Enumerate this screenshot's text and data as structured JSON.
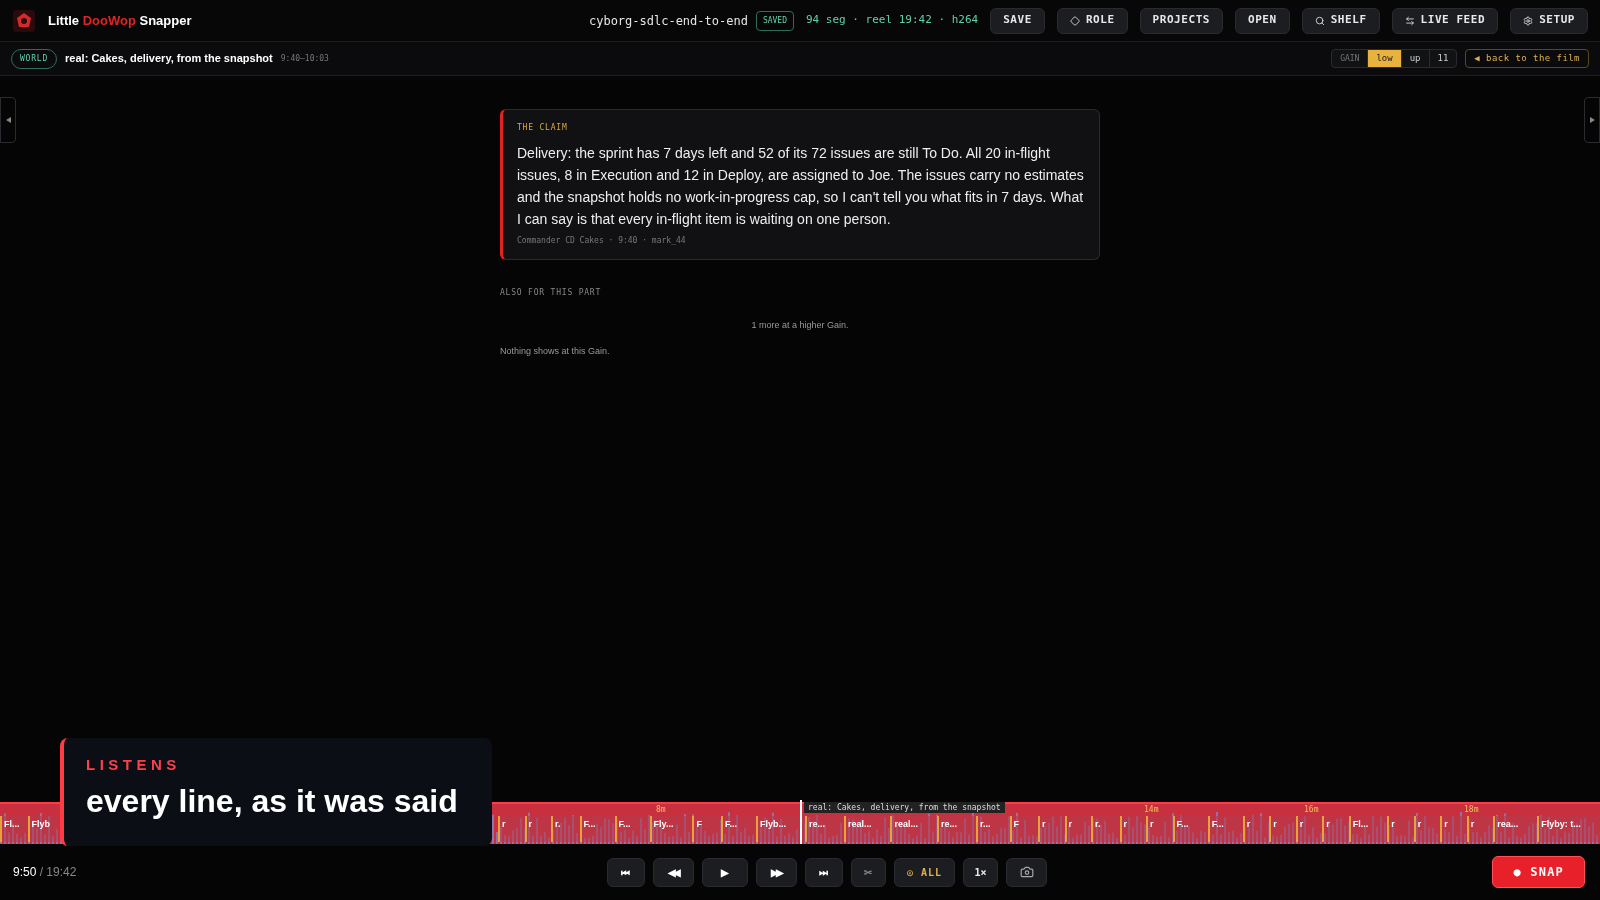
{
  "app": {
    "name_parts": [
      {
        "text": "Little ",
        "accent": false
      },
      {
        "text": "DooWop",
        "accent": true
      },
      {
        "text": " Snapper",
        "accent": false
      }
    ]
  },
  "project": {
    "name": "cyborg-sdlc-end-to-end",
    "status": "SAVED",
    "stats": "94 seg · reel 19:42 · h264"
  },
  "header_buttons": [
    {
      "label": "SAVE",
      "kind": "save"
    },
    {
      "label": "ROLE",
      "kind": "role"
    },
    {
      "label": "PROJECTS",
      "kind": "projects"
    },
    {
      "label": "OPEN",
      "kind": "open"
    },
    {
      "label": "SHELF",
      "kind": "shelf"
    },
    {
      "label": "LIVE FEED",
      "kind": "feed"
    },
    {
      "label": "SETUP",
      "kind": "setup"
    }
  ],
  "scene_bar": {
    "badge": "WORLD",
    "title": "real: Cakes, delivery, from the snapshot",
    "range": "9:40–10:03",
    "gain": {
      "label": "GAIN",
      "options": [
        {
          "label": "low",
          "selected": true
        },
        {
          "label": "up",
          "selected": false
        },
        {
          "label": "11",
          "selected": false
        }
      ]
    },
    "back_link": "◀ back to the film"
  },
  "claim": {
    "heading": "THE CLAIM",
    "text": "Delivery: the sprint has 7 days left and 52 of its 72 issues are still To Do. All 20 in-flight issues, 8 in Execution and 12 in Deploy, are assigned to Joe. The issues carry no estimates and the snapshot holds no work-in-progress cap, so I can't tell you what fits in 7 days. What I can say is that every in-flight item is waiting on one person.",
    "meta": "Commander CD Cakes · 9:40 · mark_44"
  },
  "also": {
    "heading": "ALSO FOR THIS PART",
    "more_note": "1 more at a higher Gain.",
    "empty_note": "Nothing shows at this Gain."
  },
  "caption": {
    "label": "LISTENS",
    "text": "every line, as it was said"
  },
  "timeline": {
    "playhead": {
      "level": 0.5,
      "tooltip": "real: Cakes, delivery, from the snapshot"
    },
    "ticks": [
      "8m",
      "14m",
      "16m",
      "18m"
    ],
    "segments_before": [
      "Fl...",
      "Flyb"
    ],
    "segments_after": [
      "r",
      "r",
      "r.",
      "F...",
      "F...",
      "Fly...",
      "F",
      "F...",
      "Flyb...",
      "re...",
      "real...",
      "real...",
      "re...",
      "r...",
      "F",
      "r",
      "r",
      "r.",
      "r",
      "r",
      "F...",
      "F...",
      "r",
      "r",
      "r",
      "r",
      "Fl...",
      "r",
      "r",
      "r",
      "r",
      "rea...",
      "Flyby: t..."
    ]
  },
  "transport": {
    "time": "9:50",
    "total": "/ 19:42",
    "buttons": [
      {
        "kind": "skip-back",
        "label": "⏮"
      },
      {
        "kind": "rewind",
        "label": "◀◀"
      },
      {
        "kind": "play",
        "label": "▶"
      },
      {
        "kind": "forward",
        "label": "▶▶"
      },
      {
        "kind": "skip-forward",
        "label": "⏭"
      },
      {
        "kind": "scissors",
        "label": "✂"
      },
      {
        "kind": "all",
        "label": "◎ ALL"
      },
      {
        "kind": "speed",
        "label": "1×"
      },
      {
        "kind": "camera"
      }
    ],
    "snap": "● SNAP"
  }
}
